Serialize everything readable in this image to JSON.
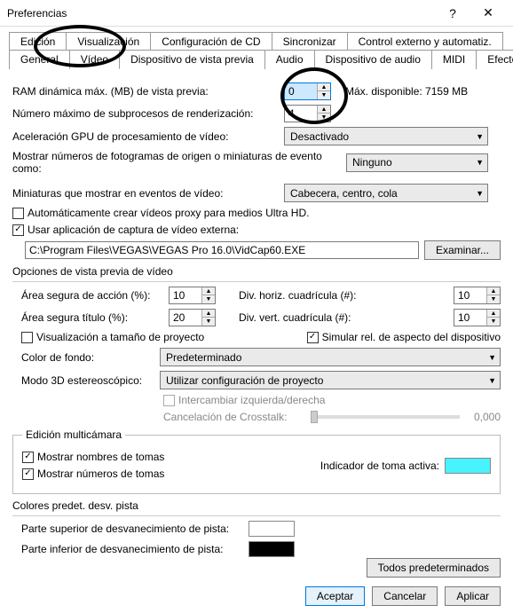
{
  "window": {
    "title": "Preferencias",
    "help": "?",
    "close": "✕"
  },
  "tabs_row1": [
    "Edición",
    "Visualización",
    "Configuración de CD",
    "Sincronizar",
    "Control externo y automatiz."
  ],
  "tabs_row2": [
    "General",
    "Vídeo",
    "Dispositivo de vista previa",
    "Audio",
    "Dispositivo de audio",
    "MIDI",
    "Efectos VST"
  ],
  "active_tab": "Vídeo",
  "fields": {
    "ram_label": "RAM dinámica máx. (MB) de vista previa:",
    "ram_value": "0",
    "ram_max": "Máx. disponible: 7159 MB",
    "threads_label": "Número máximo de subprocesos de renderización:",
    "threads_value": "4",
    "gpu_label": "Aceleración GPU de procesamiento de vídeo:",
    "gpu_value": "Desactivado",
    "frames_label": "Mostrar números de fotogramas de origen o miniaturas de evento como:",
    "frames_value": "Ninguno",
    "thumbs_label": "Miniaturas que mostrar en eventos de vídeo:",
    "thumbs_value": "Cabecera, centro, cola",
    "proxy_label": "Automáticamente crear vídeos proxy para medios Ultra HD.",
    "extcap_label": "Usar aplicación de captura de vídeo externa:",
    "extcap_path": "C:\\Program Files\\VEGAS\\VEGAS Pro 16.0\\VidCap60.EXE",
    "browse": "Examinar...",
    "preview_opts_title": "Opciones de vista previa de vídeo",
    "action_safe_label": "Área segura de acción (%):",
    "action_safe_value": "10",
    "title_safe_label": "Área segura título (%):",
    "title_safe_value": "20",
    "grid_h_label": "Div. horiz. cuadrícula (#):",
    "grid_h_value": "10",
    "grid_v_label": "Div. vert. cuadrícula (#):",
    "grid_v_value": "10",
    "proj_size_label": "Visualización a tamaño de proyecto",
    "sim_aspect_label": "Simular rel. de aspecto del dispositivo",
    "bg_label": "Color de fondo:",
    "bg_value": "Predeterminado",
    "stereo_label": "Modo 3D estereoscópico:",
    "stereo_value": "Utilizar configuración de proyecto",
    "swap_label": "Intercambiar izquierda/derecha",
    "crosstalk_label": "Cancelación de Crosstalk:",
    "crosstalk_value": "0,000",
    "multicam_title": "Edición multicámara",
    "show_take_names": "Mostrar nombres de tomas",
    "show_take_numbers": "Mostrar números de tomas",
    "active_take_label": "Indicador de toma activa:",
    "track_colors_title": "Colores predet. desv. pista",
    "fade_top_label": "Parte superior de desvanecimiento de pista:",
    "fade_bottom_label": "Parte inferior de desvanecimiento de pista:",
    "reset_all": "Todos predeterminados",
    "ok": "Aceptar",
    "cancel": "Cancelar",
    "apply": "Aplicar"
  },
  "colors": {
    "active_take": "#46f3ff",
    "fade_top": "#ffffff",
    "fade_bottom": "#000000"
  }
}
